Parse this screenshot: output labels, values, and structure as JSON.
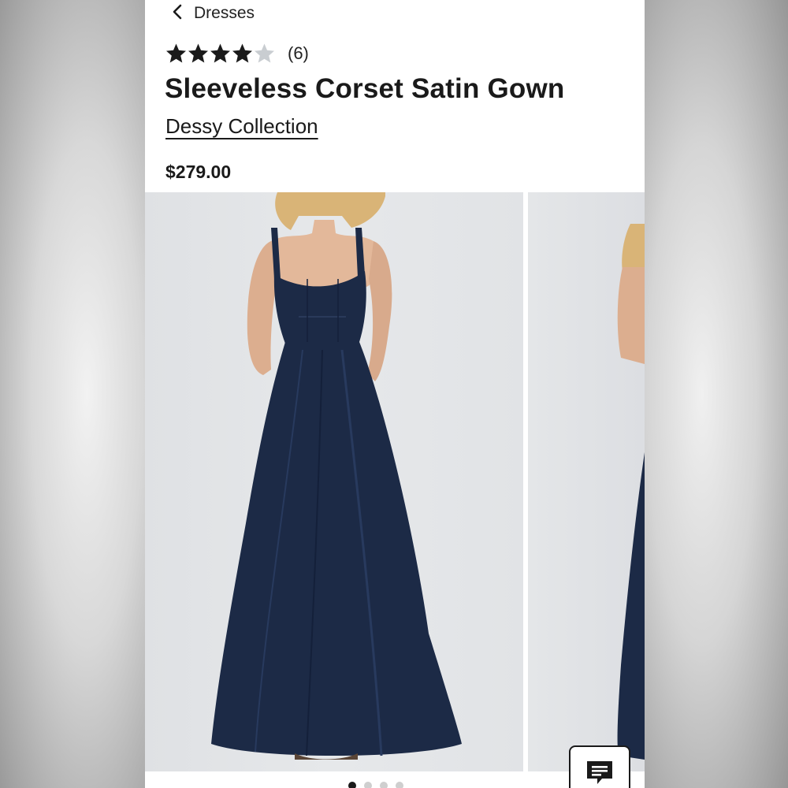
{
  "nav": {
    "back_label": "Dresses",
    "back_icon": "chevron-left-icon"
  },
  "product": {
    "rating": 4,
    "rating_max": 5,
    "review_count": "(6)",
    "title": "Sleeveless Corset Satin Gown",
    "brand": "Dessy Collection",
    "price": "$279.00"
  },
  "gallery": {
    "image_count": 4,
    "active_index": 0,
    "dress_color": "#1c2a46"
  },
  "colors": {
    "star_filled": "#1a1a1a",
    "star_empty": "#c9cdd1",
    "text": "#1a1a1a"
  },
  "chat": {
    "icon": "chat-bubble-icon"
  }
}
